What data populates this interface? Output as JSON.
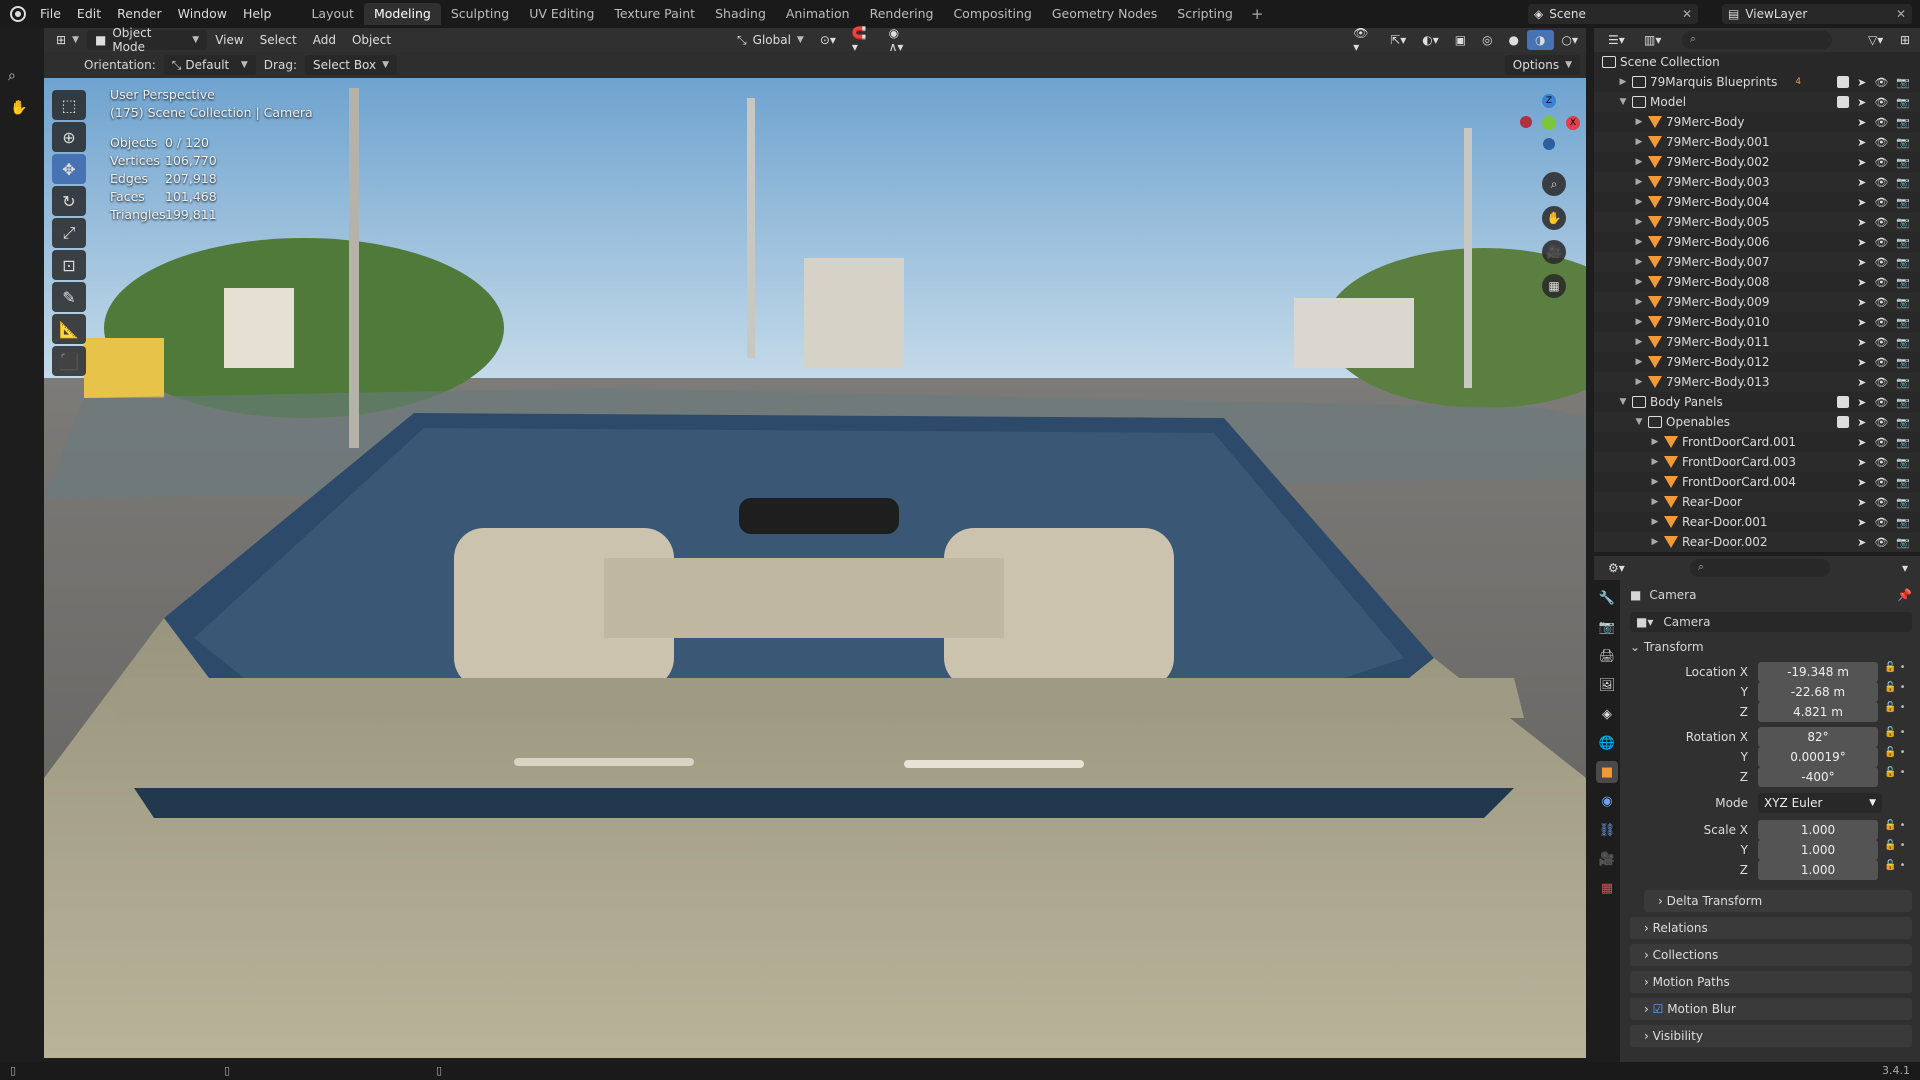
{
  "menu": [
    "File",
    "Edit",
    "Render",
    "Window",
    "Help"
  ],
  "workspaces": [
    "Layout",
    "Modeling",
    "Sculpting",
    "UV Editing",
    "Texture Paint",
    "Shading",
    "Animation",
    "Rendering",
    "Compositing",
    "Geometry Nodes",
    "Scripting"
  ],
  "active_workspace": "Modeling",
  "scene": "Scene",
  "view_layer": "ViewLayer",
  "header": {
    "mode": "Object Mode",
    "view": "View",
    "select": "Select",
    "add": "Add",
    "object": "Object",
    "transform": "Global"
  },
  "toolhead": {
    "orientation_label": "Orientation:",
    "orientation": "Default",
    "drag_label": "Drag:",
    "drag": "Select Box",
    "options": "Options"
  },
  "viewport_info": {
    "title": "User Perspective",
    "subtitle": "(175) Scene Collection | Camera",
    "stats": [
      {
        "k": "Objects",
        "v": "0 / 120"
      },
      {
        "k": "Vertices",
        "v": "106,770"
      },
      {
        "k": "Edges",
        "v": "207,918"
      },
      {
        "k": "Faces",
        "v": "101,468"
      },
      {
        "k": "Triangles",
        "v": "199,811"
      }
    ]
  },
  "outliner": {
    "root": "Scene Collection",
    "rows": [
      {
        "label": "79Marquis Blueprints",
        "depth": 1,
        "kind": "collection",
        "badge": "4"
      },
      {
        "label": "Model",
        "depth": 1,
        "kind": "collection"
      },
      {
        "label": "79Merc-Body",
        "depth": 2,
        "kind": "mesh"
      },
      {
        "label": "79Merc-Body.001",
        "depth": 2,
        "kind": "mesh"
      },
      {
        "label": "79Merc-Body.002",
        "depth": 2,
        "kind": "mesh"
      },
      {
        "label": "79Merc-Body.003",
        "depth": 2,
        "kind": "mesh"
      },
      {
        "label": "79Merc-Body.004",
        "depth": 2,
        "kind": "mesh"
      },
      {
        "label": "79Merc-Body.005",
        "depth": 2,
        "kind": "mesh"
      },
      {
        "label": "79Merc-Body.006",
        "depth": 2,
        "kind": "mesh"
      },
      {
        "label": "79Merc-Body.007",
        "depth": 2,
        "kind": "mesh"
      },
      {
        "label": "79Merc-Body.008",
        "depth": 2,
        "kind": "mesh"
      },
      {
        "label": "79Merc-Body.009",
        "depth": 2,
        "kind": "mesh"
      },
      {
        "label": "79Merc-Body.010",
        "depth": 2,
        "kind": "mesh"
      },
      {
        "label": "79Merc-Body.011",
        "depth": 2,
        "kind": "mesh"
      },
      {
        "label": "79Merc-Body.012",
        "depth": 2,
        "kind": "mesh"
      },
      {
        "label": "79Merc-Body.013",
        "depth": 2,
        "kind": "mesh"
      },
      {
        "label": "Body Panels",
        "depth": 1,
        "kind": "collection"
      },
      {
        "label": "Openables",
        "depth": 2,
        "kind": "collection"
      },
      {
        "label": "FrontDoorCard.001",
        "depth": 3,
        "kind": "mesh"
      },
      {
        "label": "FrontDoorCard.003",
        "depth": 3,
        "kind": "mesh"
      },
      {
        "label": "FrontDoorCard.004",
        "depth": 3,
        "kind": "mesh"
      },
      {
        "label": "Rear-Door",
        "depth": 3,
        "kind": "mesh"
      },
      {
        "label": "Rear-Door.001",
        "depth": 3,
        "kind": "mesh"
      },
      {
        "label": "Rear-Door.002",
        "depth": 3,
        "kind": "mesh"
      }
    ]
  },
  "properties": {
    "object_name": "Camera",
    "data_name": "Camera",
    "transform_label": "Transform",
    "location": {
      "label": "Location X",
      "x": "-19.348 m",
      "y": "-22.68 m",
      "z": "4.821 m"
    },
    "rotation": {
      "label": "Rotation X",
      "x": "82°",
      "y": "0.00019°",
      "z": "-400°"
    },
    "mode_label": "Mode",
    "mode": "XYZ Euler",
    "scale": {
      "label": "Scale X",
      "x": "1.000",
      "y": "1.000",
      "z": "1.000"
    },
    "axis_y": "Y",
    "axis_z": "Z",
    "sections": [
      "Delta Transform",
      "Relations",
      "Collections",
      "Motion Paths",
      "Motion Blur",
      "Visibility"
    ]
  },
  "version": "3.4.1",
  "colors": {
    "accent": "#4772b3",
    "mesh": "#f29a38",
    "x_axis": "#e0404d",
    "y_axis": "#7cc63b",
    "z_axis": "#3b82d6"
  }
}
